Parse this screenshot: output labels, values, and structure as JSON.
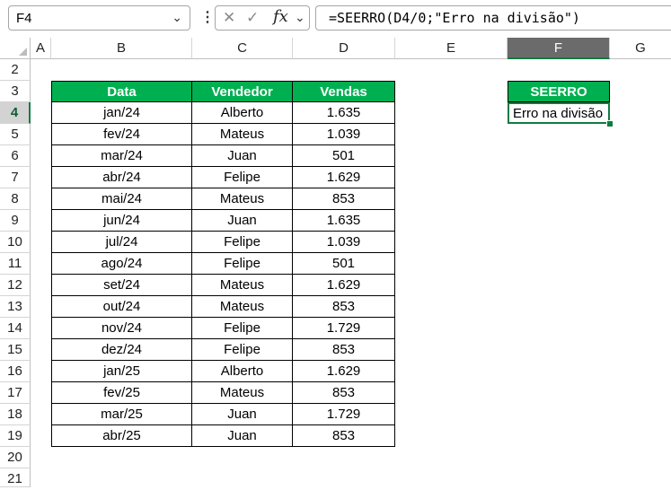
{
  "formula_bar": {
    "name_box": "F4",
    "fx_label": "fx",
    "formula": "=SEERRO(D4/0;\"Erro na divisão\")"
  },
  "columns": [
    "A",
    "B",
    "C",
    "D",
    "E",
    "F",
    "G"
  ],
  "rows": [
    "2",
    "3",
    "4",
    "5",
    "6",
    "7",
    "8",
    "9",
    "10",
    "11",
    "12",
    "13",
    "14",
    "15",
    "16",
    "17",
    "18",
    "19",
    "20",
    "21"
  ],
  "table": {
    "headers": [
      "Data",
      "Vendedor",
      "Vendas"
    ],
    "rows": [
      [
        "jan/24",
        "Alberto",
        "1.635"
      ],
      [
        "fev/24",
        "Mateus",
        "1.039"
      ],
      [
        "mar/24",
        "Juan",
        "501"
      ],
      [
        "abr/24",
        "Felipe",
        "1.629"
      ],
      [
        "mai/24",
        "Mateus",
        "853"
      ],
      [
        "jun/24",
        "Juan",
        "1.635"
      ],
      [
        "jul/24",
        "Felipe",
        "1.039"
      ],
      [
        "ago/24",
        "Felipe",
        "501"
      ],
      [
        "set/24",
        "Mateus",
        "1.629"
      ],
      [
        "out/24",
        "Mateus",
        "853"
      ],
      [
        "nov/24",
        "Felipe",
        "1.729"
      ],
      [
        "dez/24",
        "Felipe",
        "853"
      ],
      [
        "jan/25",
        "Alberto",
        "1.629"
      ],
      [
        "fev/25",
        "Mateus",
        "853"
      ],
      [
        "mar/25",
        "Juan",
        "1.729"
      ],
      [
        "abr/25",
        "Juan",
        "853"
      ]
    ]
  },
  "seerro": {
    "header": "SEERRO",
    "result": "Erro na divisão"
  },
  "colors": {
    "header_green": "#00b050",
    "selection_green": "#107c41"
  },
  "icons": [
    "chevron-down-icon",
    "more-options-icon",
    "cancel-icon",
    "enter-icon",
    "insert-function-icon"
  ]
}
